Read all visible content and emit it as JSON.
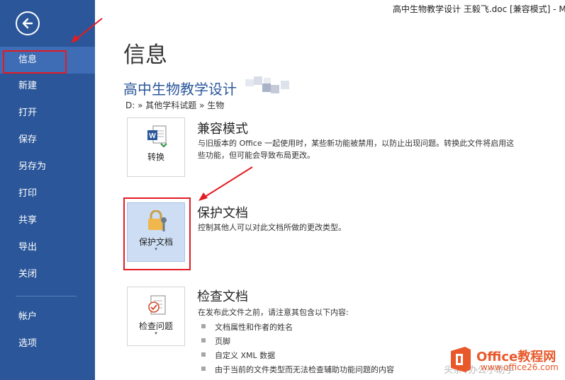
{
  "window": {
    "title": "高中生物教学设计 王毅飞.doc [兼容模式] - M"
  },
  "sidebar": {
    "items": [
      {
        "label": "信息",
        "active": true
      },
      {
        "label": "新建"
      },
      {
        "label": "打开"
      },
      {
        "label": "保存"
      },
      {
        "label": "另存为"
      },
      {
        "label": "打印"
      },
      {
        "label": "共享"
      },
      {
        "label": "导出"
      },
      {
        "label": "关闭"
      },
      {
        "label": "帐户"
      },
      {
        "label": "选项"
      }
    ]
  },
  "main": {
    "page_title": "信息",
    "doc_title": "高中生物教学设计",
    "doc_path": "D: » 其他学科试题 » 生物",
    "sections": [
      {
        "button_label": "转换",
        "heading": "兼容模式",
        "description": "与旧版本的 Office 一起使用时，某些新功能被禁用，以防止出现问题。转换此文件将启用这些功能，但可能会导致布局更改。"
      },
      {
        "button_label": "保护文档",
        "caret": "▾",
        "heading": "保护文档",
        "description": "控制其他人可以对此文档所做的更改类型。"
      },
      {
        "button_label": "检查问题",
        "caret": "▾",
        "heading": "检查文档",
        "description": "在发布此文件之前，请注意其包含以下内容:",
        "bullets": [
          "文档属性和作者的姓名",
          "页脚",
          "自定义 XML 数据",
          "由于当前的文件类型而无法检查辅助功能问题的内容"
        ]
      }
    ]
  },
  "watermark": {
    "brand": "Office教程网",
    "url": "www.office26.com",
    "faint": "头条 /办公小助手"
  },
  "colors": {
    "sidebar": "#2b579a",
    "accent": "#2b579a",
    "highlight_box": "#e31b23",
    "selected_tile": "#cdddf3"
  }
}
